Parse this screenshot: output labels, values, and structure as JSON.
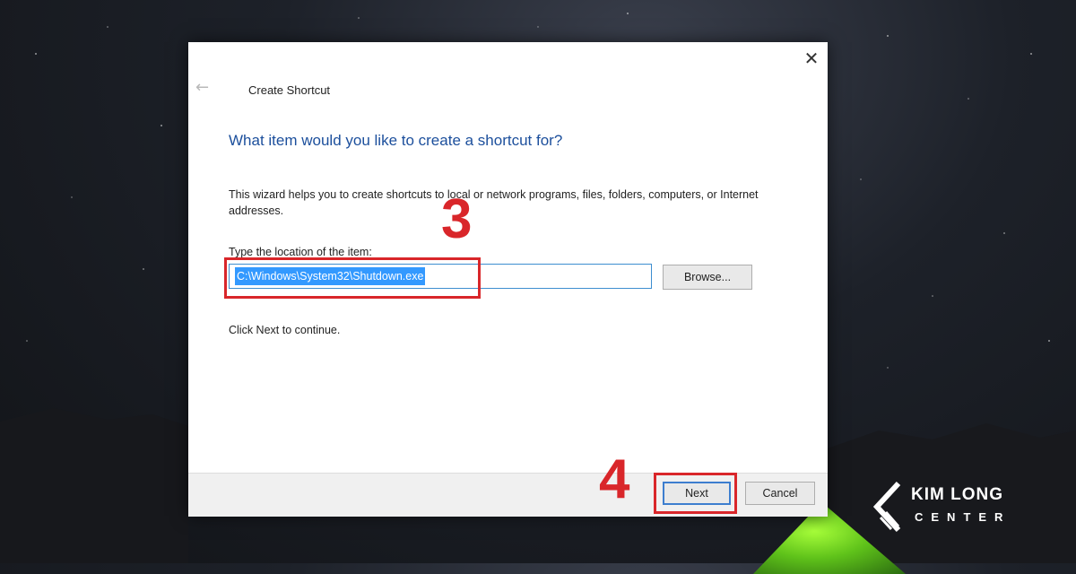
{
  "dialog": {
    "title": "Create Shortcut",
    "close_icon": "✕",
    "back_icon": "←",
    "question": "What item would you like to create a shortcut for?",
    "intro": "This wizard helps you to create shortcuts to local or network programs, files, folders, computers, or Internet addresses.",
    "location_label": "Type the location of the item:",
    "location_value": "C:\\Windows\\System32\\Shutdown.exe",
    "browse_label": "Browse...",
    "continue_text": "Click Next to continue.",
    "next_label": "Next",
    "cancel_label": "Cancel"
  },
  "annotations": {
    "step3": "3",
    "step4": "4",
    "color": "#d9262a"
  },
  "logo": {
    "line1": "KIM LONG",
    "line2": "CENTER"
  },
  "colors": {
    "question_text": "#1c4f9c",
    "selection": "#3399ff",
    "input_border": "#3d8ed0"
  }
}
